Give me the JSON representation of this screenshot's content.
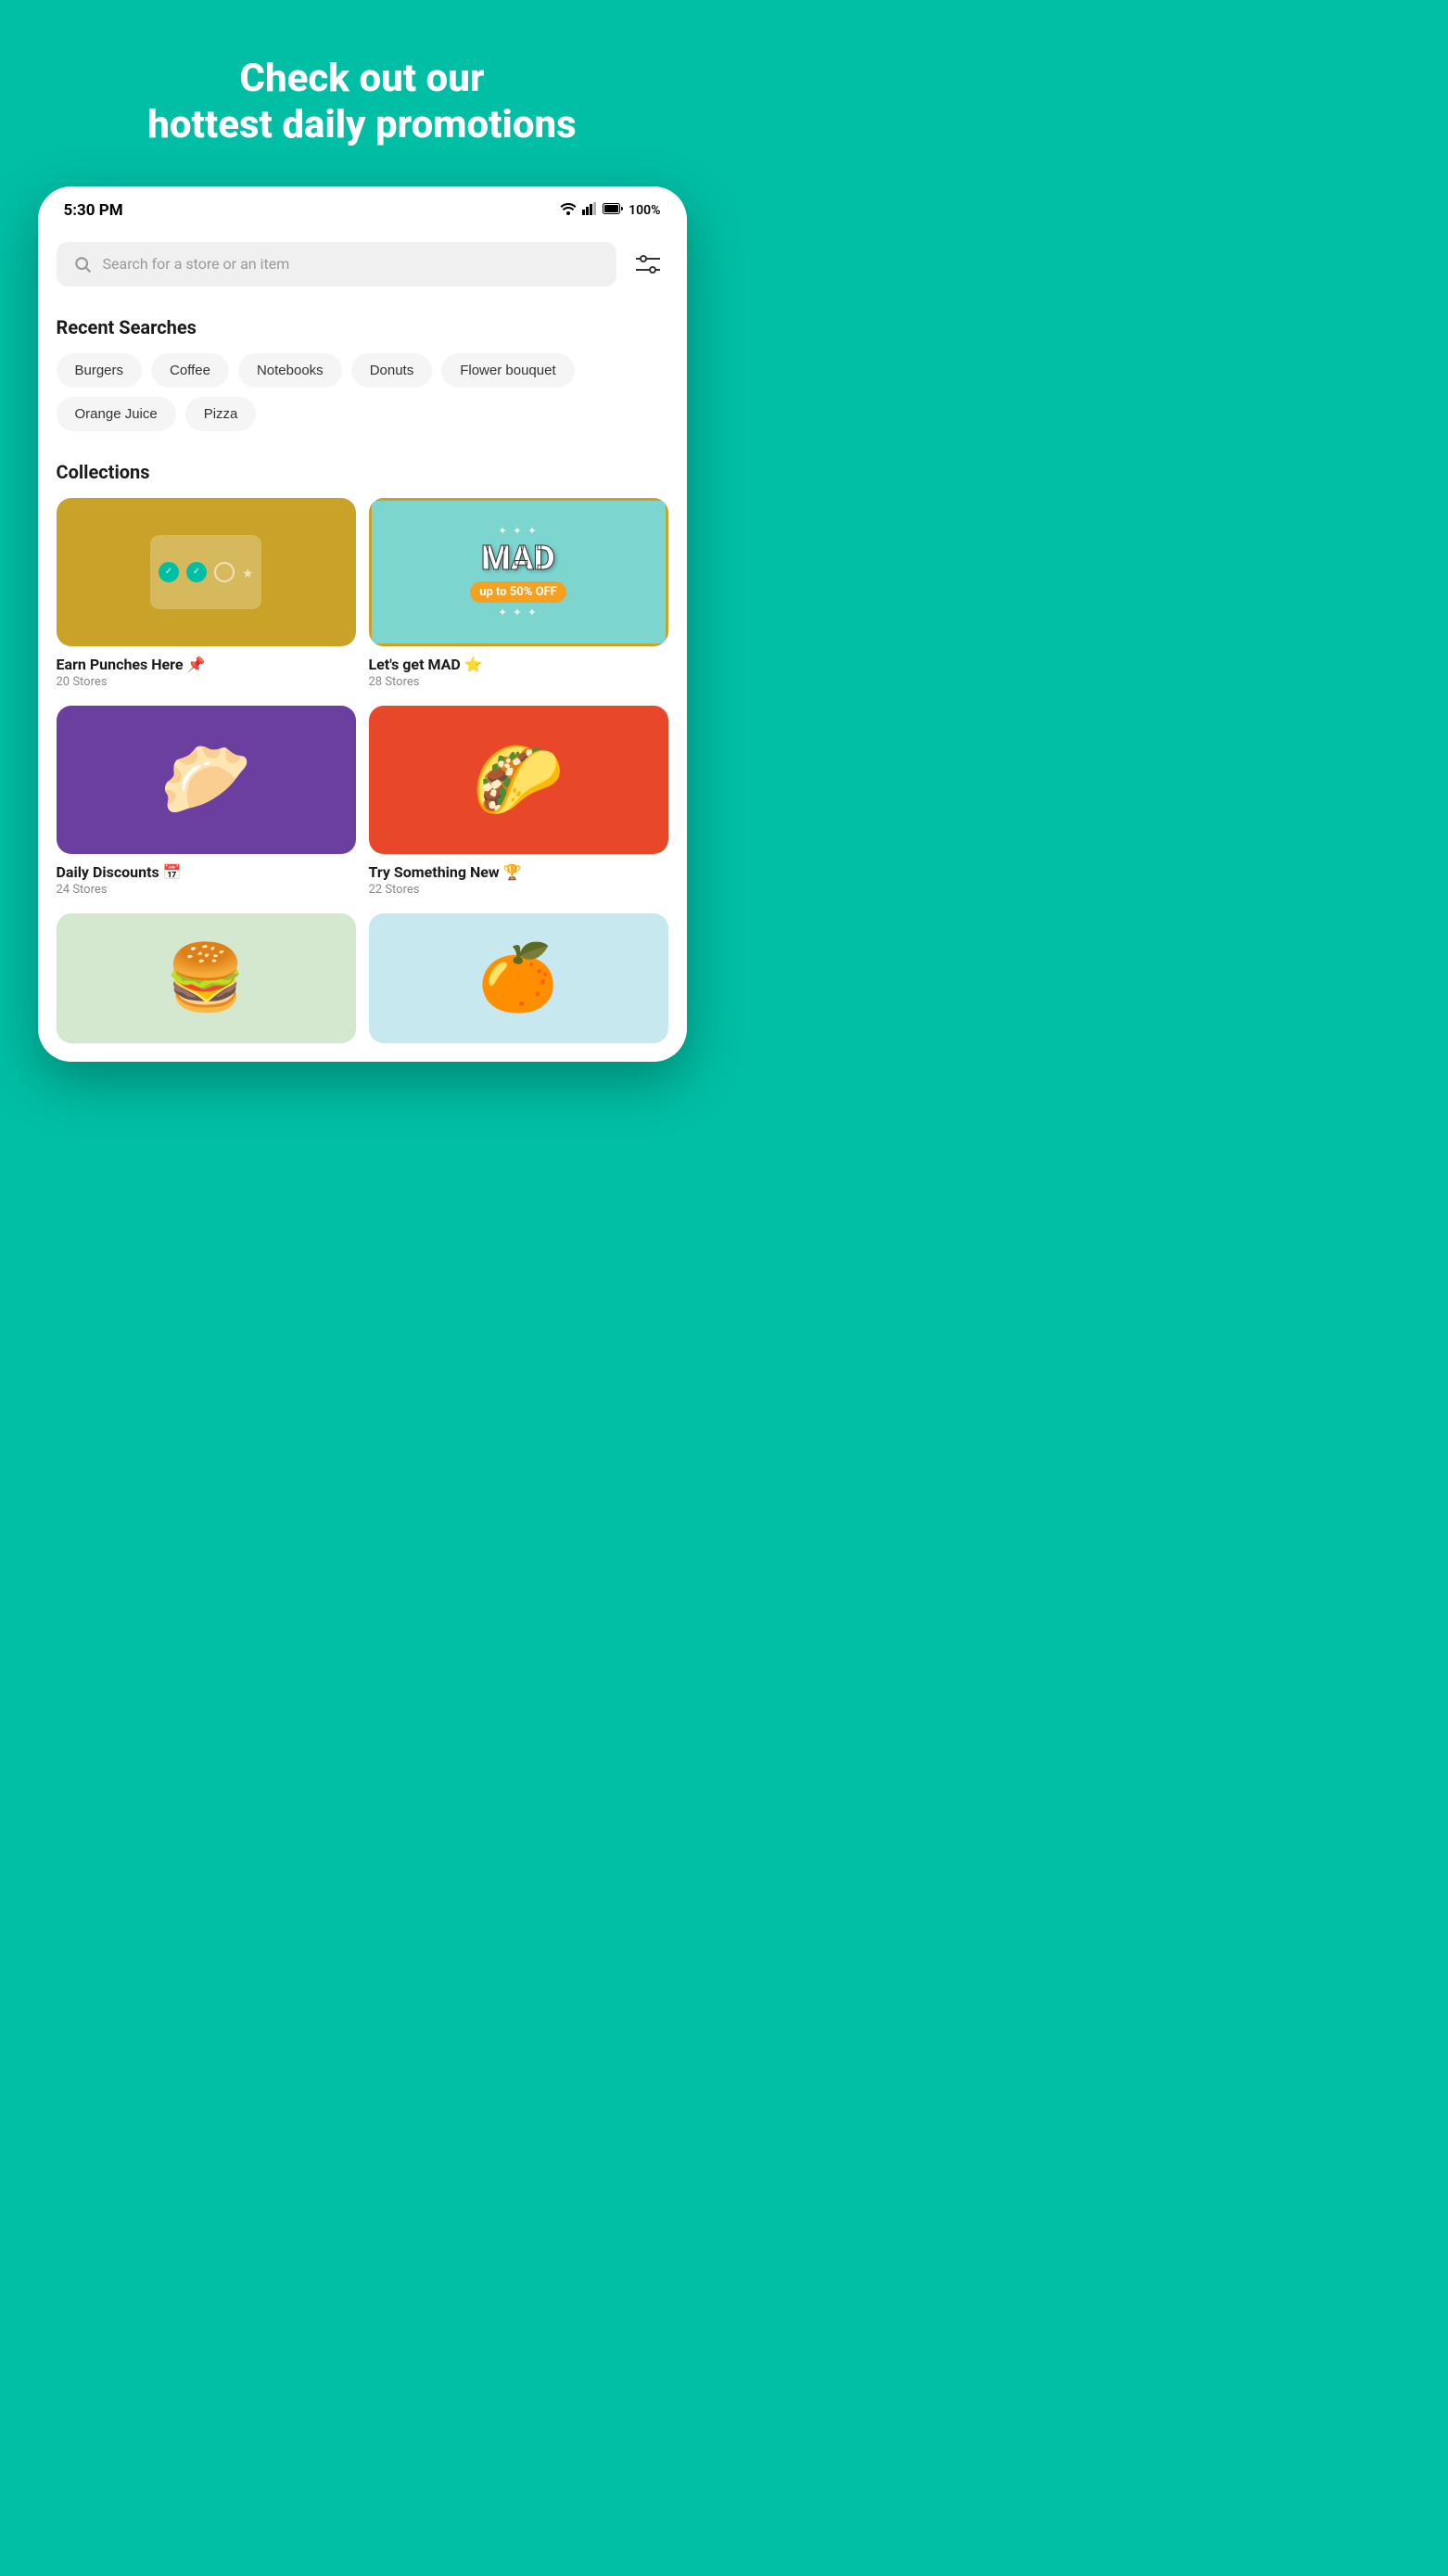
{
  "header": {
    "title_line1": "Check out our",
    "title_line2": "hottest daily promotions",
    "bg_color": "#00BFA5"
  },
  "status_bar": {
    "time": "5:30 PM",
    "battery": "100%"
  },
  "search": {
    "placeholder": "Search for a store or an item"
  },
  "recent_searches": {
    "title": "Recent Searches",
    "tags": [
      "Burgers",
      "Coffee",
      "Notebooks",
      "Donuts",
      "Flower bouquet",
      "Orange Juice",
      "Pizza"
    ]
  },
  "collections": {
    "title": "Collections",
    "items": [
      {
        "name": "Earn Punches Here 📌",
        "stores": "20 Stores",
        "type": "earn-punches"
      },
      {
        "name": "Let's get MAD ⭐",
        "stores": "28 Stores",
        "type": "mad"
      },
      {
        "name": "Daily Discounts 📅",
        "stores": "24 Stores",
        "type": "daily-discounts"
      },
      {
        "name": "Try Something New 🏆",
        "stores": "22 Stores",
        "type": "try-something-new"
      }
    ]
  }
}
